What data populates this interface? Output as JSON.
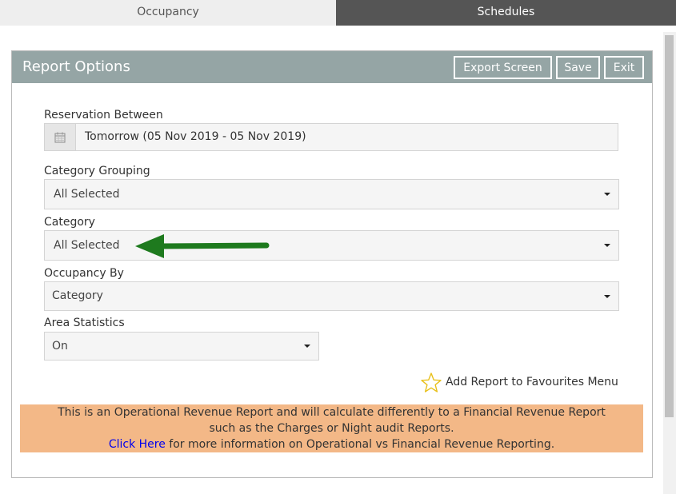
{
  "tabs": [
    {
      "label": "Occupancy"
    },
    {
      "label": "Schedules"
    }
  ],
  "panel": {
    "title": "Report Options",
    "buttons": {
      "export_screen": "Export Screen",
      "save": "Save",
      "exit": "Exit"
    }
  },
  "form": {
    "reservation_between": {
      "label": "Reservation Between",
      "value": "Tomorrow (05 Nov 2019 - 05 Nov 2019)",
      "icon": "calendar-icon"
    },
    "category_grouping": {
      "label": "Category Grouping",
      "value": "All Selected"
    },
    "category": {
      "label": "Category",
      "value": "All Selected"
    },
    "occupancy_by": {
      "label": "Occupancy By",
      "value": "Category"
    },
    "area_statistics": {
      "label": "Area Statistics",
      "value": "On"
    }
  },
  "favourites": {
    "label": "Add Report to Favourites Menu",
    "icon": "star-icon"
  },
  "notice": {
    "line1": "This is an Operational Revenue Report and will calculate differently to a Financial Revenue Report",
    "line2": "such as the Charges or Night audit Reports.",
    "link_text": "Click Here",
    "line3_rest": " for more information on Operational vs Financial Revenue Reporting."
  },
  "colors": {
    "header": "#95a5a5",
    "active_tab": "#555555",
    "notice_bg": "#f3b887",
    "arrow": "#1e7a1e"
  }
}
